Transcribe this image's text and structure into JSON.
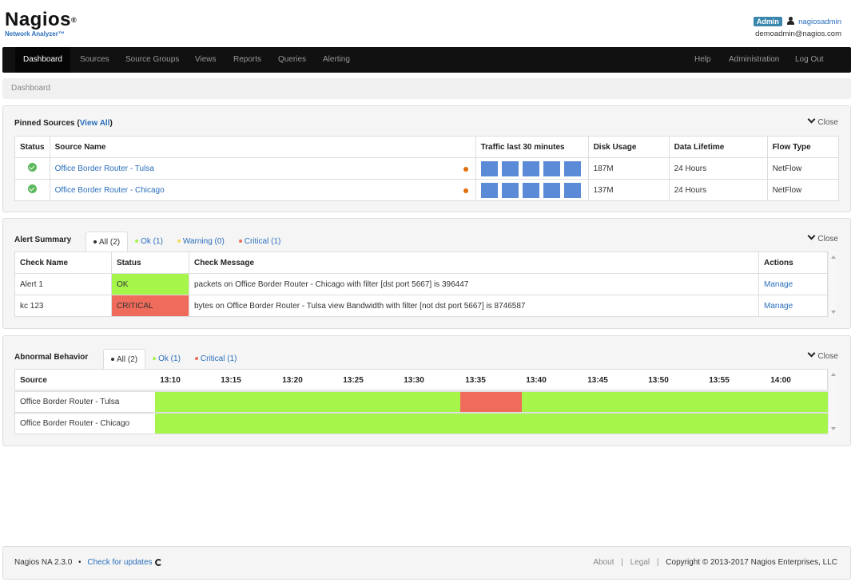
{
  "brand": {
    "name": "Nagios",
    "registered": "®",
    "subtitle": "Network Analyzer™"
  },
  "user": {
    "badge": "Admin",
    "username": "nagiosadmin",
    "email": "demoadmin@nagios.com"
  },
  "nav": {
    "left": [
      "Dashboard",
      "Sources",
      "Source Groups",
      "Views",
      "Reports",
      "Queries",
      "Alerting"
    ],
    "right": [
      "Help",
      "Administration",
      "Log Out"
    ]
  },
  "breadcrumb": "Dashboard",
  "pinned": {
    "title": "Pinned Sources (",
    "view_all": "View All",
    "title_end": ")",
    "close": "Close",
    "columns": [
      "Status",
      "Source Name",
      "Traffic last 30 minutes",
      "Disk Usage",
      "Data Lifetime",
      "Flow Type"
    ],
    "rows": [
      {
        "name": "Office Border Router - Tulsa",
        "disk": "187M",
        "lifetime": "24 Hours",
        "flow": "NetFlow"
      },
      {
        "name": "Office Border Router - Chicago",
        "disk": "137M",
        "lifetime": "24 Hours",
        "flow": "NetFlow"
      }
    ]
  },
  "alerts": {
    "title": "Alert Summary",
    "close": "Close",
    "tabs": [
      "All (2)",
      "Ok (1)",
      "Warning (0)",
      "Critical (1)"
    ],
    "columns": [
      "Check Name",
      "Status",
      "Check Message",
      "Actions"
    ],
    "rows": [
      {
        "name": "Alert 1",
        "status": "OK",
        "message": "packets on Office Border Router - Chicago with filter [dst port 5667] is 396447",
        "action": "Manage"
      },
      {
        "name": "kc 123",
        "status": "CRITICAL",
        "message": "bytes on Office Border Router - Tulsa view Bandwidth with filter [not dst port 5667] is 8746587",
        "action": "Manage"
      }
    ]
  },
  "abnormal": {
    "title": "Abnormal Behavior",
    "close": "Close",
    "tabs": [
      "All (2)",
      "Ok (1)",
      "Critical (1)"
    ],
    "source_header": "Source",
    "times": [
      "13:10",
      "13:15",
      "13:20",
      "13:25",
      "13:30",
      "13:35",
      "13:40",
      "13:45",
      "13:50",
      "13:55",
      "14:00"
    ],
    "rows": [
      {
        "name": "Office Border Router - Tulsa"
      },
      {
        "name": "Office Border Router - Chicago"
      }
    ]
  },
  "footer": {
    "version": "Nagios NA 2.3.0",
    "sep": "•",
    "updates": "Check for updates",
    "about": "About",
    "legal": "Legal",
    "divider": "|",
    "copyright": "Copyright © 2013-2017 Nagios Enterprises, LLC"
  },
  "colors": {
    "ok": "#a5f54b",
    "critical": "#ef6b5b",
    "link": "#2a6ebb",
    "spark": "#5b8ad6"
  }
}
